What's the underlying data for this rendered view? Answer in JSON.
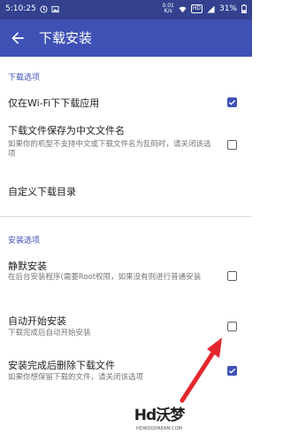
{
  "status_bar": {
    "time": "5:10:25",
    "network_speed": "0.01\nK/s",
    "network_badge": "HD",
    "battery": "31%",
    "icons": [
      "clock-icon",
      "image-icon",
      "wifi-icon",
      "signal-icon",
      "battery-icon"
    ]
  },
  "toolbar": {
    "title": "下载安装",
    "back_icon": "arrow-back-icon"
  },
  "sections": {
    "download": "下载选项",
    "install": "安装选项"
  },
  "settings": [
    {
      "title": "仅在Wi-Fi下下载应用",
      "summary": "",
      "checked": true
    },
    {
      "title": "下载文件保存为中文文件名",
      "summary": "如果你的机型不支持中文或下载文件名为乱码时，请关闭该选项",
      "checked": false
    },
    {
      "title": "自定义下载目录",
      "summary": ""
    },
    {
      "title": "静默安装",
      "summary": "在后台安装程序(需要Root权限，如果没有则进行普通安装",
      "checked": false
    },
    {
      "title": "自动开始安装",
      "summary": "下载完成后自动开始安装",
      "checked": false
    },
    {
      "title": "安装完成后删除下载文件",
      "summary": "如果你想保留下载的文件，请关闭该选项",
      "checked": true
    }
  ],
  "watermark": {
    "main": "Hd沃梦",
    "sub": "HDWOODREAM.COM"
  },
  "colors": {
    "primary": "#3f51b5",
    "status_bar": "#33418f",
    "annotation_arrow": "#e5262d"
  }
}
